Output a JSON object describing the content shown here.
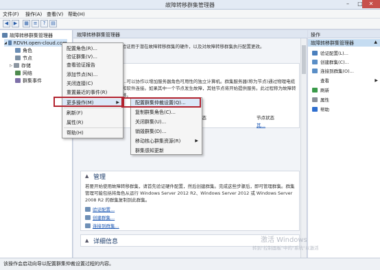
{
  "window": {
    "title": "故障转移群集管理器"
  },
  "menubar": [
    {
      "label": "文件(F)"
    },
    {
      "label": "操作(A)"
    },
    {
      "label": "查看(V)"
    },
    {
      "label": "帮助(H)"
    }
  ],
  "tree": {
    "root": "故障转移群集管理器",
    "cluster": "RDVH.open-cloud.com",
    "items": [
      "角色",
      "节点",
      "存储",
      "网络",
      "群集事件"
    ]
  },
  "content": {
    "header": "故障转移群集管理器",
    "intro": "创建故障转移群集，验证用于潜在故障转移群集的硬件，以及对故障转移群集执行配置更改。",
    "overview_text": "…可以协作以增加服务器角色可用性的独立计算机。群集服务器(称为节点)通过物理电缆和软件连接。如果其中一个节点发生故障，其他节点将开始提供服务。此过程称为故障转移。",
    "column_header_1": "…态",
    "column_header_2": "节点状态",
    "column_value_2": "其…",
    "management": {
      "title": "管理",
      "text": "若要开始使用故障转移群集，请首先验证硬件配置，然后创建群集。完成这些步骤后，即可管理群集。群集管理可能包括将角色从运行 Windows Server 2012 R2、Windows Server 2012 或 Windows Server 2008 R2 的群集复制到此群集。",
      "links": [
        "验证配置...",
        "创建群集...",
        "连接到群集..."
      ]
    },
    "details_title": "详细信息"
  },
  "actions": {
    "header": "操作",
    "group": "故障转移群集管理器",
    "items": [
      {
        "label": "验证配置(L)...",
        "icon": "validate-icon"
      },
      {
        "label": "创建群集(C)...",
        "icon": "create-icon"
      },
      {
        "label": "连接到群集(O)...",
        "icon": "connect-icon"
      },
      {
        "label": "查看",
        "icon": "none",
        "submenu": true
      },
      {
        "label": "刷新",
        "icon": "refresh-icon"
      },
      {
        "label": "属性",
        "icon": "properties-icon"
      },
      {
        "label": "帮助",
        "icon": "help-icon"
      }
    ]
  },
  "context_menu": {
    "items": [
      "配置角色(R)...",
      "验证群集(V)...",
      "查看验证报告",
      "添加节点(N)...",
      "关闭连接(C)",
      "重置最近的事件(R)",
      "更多操作(M)",
      "刷新(F)",
      "属性(R)",
      "帮助(H)"
    ]
  },
  "submenu": {
    "items": [
      "配置群集仲裁设置(Q)...",
      "复制群集角色(C)...",
      "关闭群集(U)...",
      "销毁群集(D)...",
      "移动核心群集资源(R)",
      "群集感知更新"
    ]
  },
  "statusbar": {
    "text": "该操作会启动向导以配置群集仲裁设置过程的内容。"
  },
  "watermark": {
    "line1": "激活 Windows",
    "line2": "转到\"控制面板\"中的\"系统\"以激活"
  },
  "colors": {
    "highlight_frame": "#b2222e",
    "accent": "#1a56b3"
  }
}
